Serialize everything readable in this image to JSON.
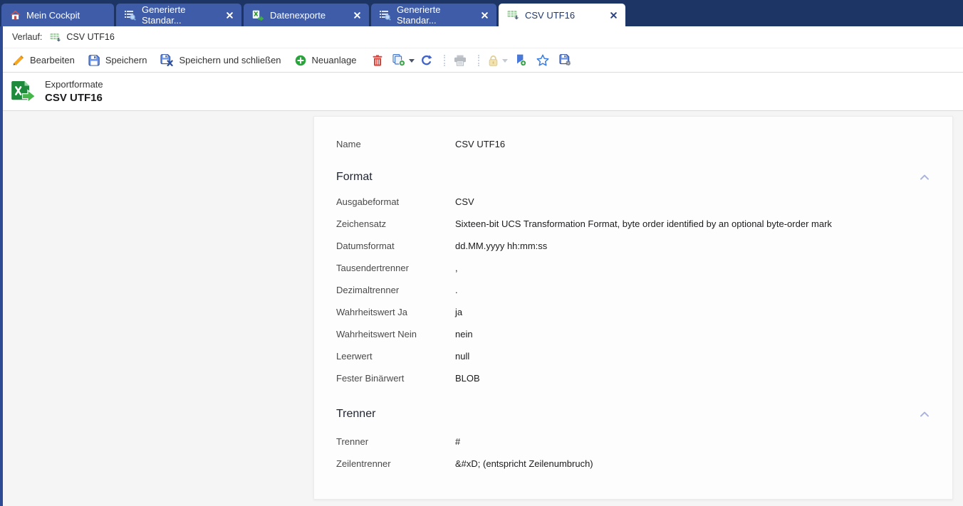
{
  "colors": {
    "tabbar_bg": "#1d3564",
    "tab_inactive_bg": "#3e5ca8",
    "tab_active_bg": "#ffffff",
    "tab_inactive_text": "#ffffff",
    "tab_active_text": "#21386b",
    "left_strip": "#2d4a94",
    "content_bg": "#f5f5f6",
    "panel_bg": "#fdfdfe",
    "toolbar_text": "#333333",
    "label_text": "#4a4a4a",
    "value_text": "#1c1c1e",
    "section_chevron": "#a9b3dc",
    "accent_green": "#2ba33c",
    "accent_red": "#d9453d",
    "accent_blue": "#3f62c9",
    "accent_orange": "#f5a623",
    "lock_yellow": "#f3e3ae"
  },
  "tabs": [
    {
      "label": "Mein Cockpit",
      "icon": "home-icon",
      "closable": false,
      "active": false
    },
    {
      "label": "Generierte Standar...",
      "icon": "list-search-icon",
      "closable": true,
      "active": false
    },
    {
      "label": "Datenexporte",
      "icon": "data-export-icon",
      "closable": true,
      "active": false
    },
    {
      "label": "Generierte Standar...",
      "icon": "list-search-icon",
      "closable": true,
      "active": false
    },
    {
      "label": "CSV UTF16",
      "icon": "csv-file-icon",
      "closable": true,
      "active": true
    }
  ],
  "history_bar": {
    "label": "Verlauf:",
    "item_label": "CSV UTF16",
    "item_icon": "csv-file-icon"
  },
  "toolbar": {
    "buttons": [
      {
        "label": "Bearbeiten",
        "icon": "edit-pencil-icon"
      },
      {
        "label": "Speichern",
        "icon": "save-icon"
      },
      {
        "label": "Speichern und schließen",
        "icon": "save-and-close-icon"
      },
      {
        "label": "Neuanlage",
        "icon": "new-record-icon"
      }
    ],
    "icon_buttons": [
      {
        "icon": "delete-trash-icon",
        "enabled": true
      },
      {
        "icon": "copy-add-icon",
        "enabled": true,
        "has_dropdown": true
      },
      {
        "icon": "refresh-icon",
        "enabled": true
      },
      {
        "icon": "print-icon",
        "enabled": false
      },
      {
        "icon": "lock-icon",
        "enabled": false,
        "has_dropdown": true
      },
      {
        "icon": "bookmark-add-icon",
        "enabled": true
      },
      {
        "icon": "favorite-star-icon",
        "enabled": true
      },
      {
        "icon": "save-settings-icon",
        "enabled": true
      }
    ]
  },
  "record_header": {
    "type_label": "Exportformate",
    "title": "CSV UTF16",
    "icon": "export-format-icon"
  },
  "form": {
    "name_field": {
      "label": "Name",
      "value": "CSV UTF16"
    },
    "sections": [
      {
        "title": "Format",
        "collapse_icon": "chevron-up-icon",
        "fields": [
          {
            "label": "Ausgabeformat",
            "value": "CSV"
          },
          {
            "label": "Zeichensatz",
            "value": "Sixteen-bit UCS Transformation Format, byte order identified by an optional byte-order mark"
          },
          {
            "label": "Datumsformat",
            "value": "dd.MM.yyyy hh:mm:ss"
          },
          {
            "label": "Tausendertrenner",
            "value": ","
          },
          {
            "label": "Dezimaltrenner",
            "value": "."
          },
          {
            "label": "Wahrheitswert Ja",
            "value": "ja"
          },
          {
            "label": "Wahrheitswert Nein",
            "value": "nein"
          },
          {
            "label": "Leerwert",
            "value": "null"
          },
          {
            "label": "Fester Binärwert",
            "value": "BLOB"
          }
        ]
      },
      {
        "title": "Trenner",
        "collapse_icon": "chevron-up-icon",
        "fields": [
          {
            "label": "Trenner",
            "value": "#"
          },
          {
            "label": "Zeilentrenner",
            "value": "&#xD; (entspricht Zeilenumbruch)"
          }
        ]
      }
    ]
  }
}
